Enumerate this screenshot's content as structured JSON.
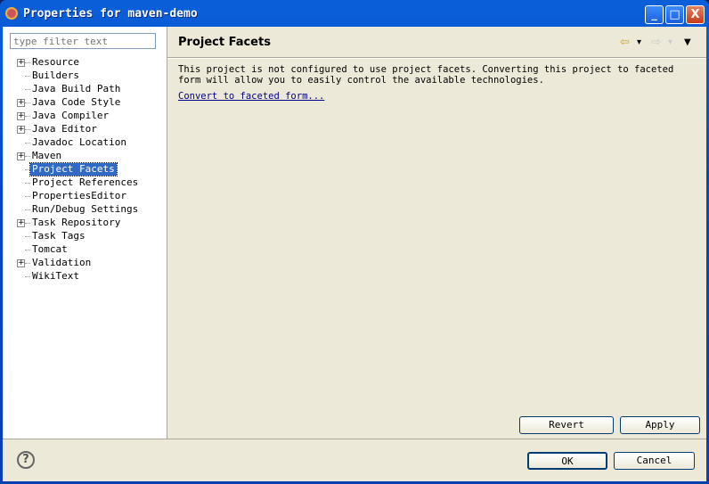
{
  "window": {
    "title": "Properties for maven-demo",
    "minimize": "_",
    "maximize": "□",
    "close": "X"
  },
  "filter": {
    "placeholder": "type filter text"
  },
  "tree": [
    {
      "label": "Resource",
      "expandable": true
    },
    {
      "label": "Builders",
      "expandable": false
    },
    {
      "label": "Java Build Path",
      "expandable": false
    },
    {
      "label": "Java Code Style",
      "expandable": true
    },
    {
      "label": "Java Compiler",
      "expandable": true
    },
    {
      "label": "Java Editor",
      "expandable": true
    },
    {
      "label": "Javadoc Location",
      "expandable": false
    },
    {
      "label": "Maven",
      "expandable": true
    },
    {
      "label": "Project Facets",
      "expandable": false,
      "selected": true
    },
    {
      "label": "Project References",
      "expandable": false
    },
    {
      "label": "PropertiesEditor",
      "expandable": false
    },
    {
      "label": "Run/Debug Settings",
      "expandable": false
    },
    {
      "label": "Task Repository",
      "expandable": true
    },
    {
      "label": "Task Tags",
      "expandable": false
    },
    {
      "label": "Tomcat",
      "expandable": false
    },
    {
      "label": "Validation",
      "expandable": true
    },
    {
      "label": "WikiText",
      "expandable": false
    }
  ],
  "page": {
    "title": "Project Facets",
    "message": "This project is not configured to use project facets. Converting this project to faceted form will allow you to easily control the available technologies.",
    "link": "Convert to faceted form..."
  },
  "nav": {
    "back": "⇦",
    "forward": "⇨",
    "dropdown": "▾",
    "menu": "▼"
  },
  "buttons": {
    "revert": "Revert",
    "apply": "Apply",
    "ok": "OK",
    "cancel": "Cancel",
    "help": "?"
  }
}
